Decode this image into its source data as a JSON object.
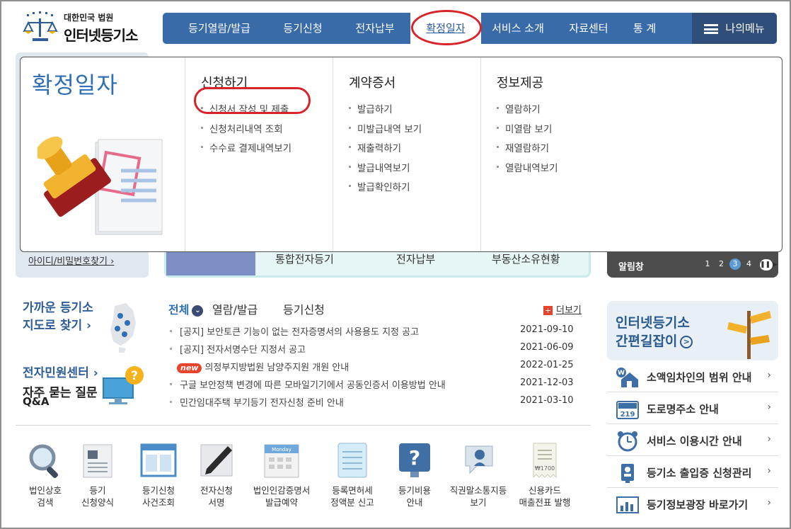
{
  "header": {
    "logo_top": "대한민국 법원",
    "logo_main": "인터넷등기소",
    "nav": [
      "등기열람/발급",
      "등기신청",
      "전자납부",
      "확정일자",
      "서비스 소개",
      "자료센터",
      "통 계"
    ],
    "active_nav": "확정일자",
    "mymenu_label": "나의메뉴"
  },
  "mega_menu": {
    "title": "확정일자",
    "columns": [
      {
        "heading": "신청하기",
        "items": [
          "신청서 작성 및 제출",
          "신청처리내역 조회",
          "수수료 결제내역보기"
        ]
      },
      {
        "heading": "계약증서",
        "items": [
          "발급하기",
          "미발급내역 보기",
          "재출력하기",
          "발급내역보기",
          "발급확인하기"
        ]
      },
      {
        "heading": "정보제공",
        "items": [
          "열람하기",
          "미열람 보기",
          "재열람하기",
          "열람내역보기"
        ]
      }
    ],
    "highlighted_item": "신청서 작성 및 제출"
  },
  "login": {
    "find_link": "아이디/비밀번호찾기 ›"
  },
  "mid_band": {
    "items": [
      "통합전자등기",
      "전자납부",
      "부동산소유현황"
    ]
  },
  "notice_bar": {
    "title": "알림창",
    "pages": [
      "1",
      "2",
      "3",
      "4"
    ],
    "current_page": "3",
    "pause": "❚❚ ▶"
  },
  "quick_left": {
    "near_title": "가까운 등기소",
    "near_sub": "지도로 찾기 ›",
    "center_title": "전자민원센터 ›",
    "faq_title": "자주 묻는 질문",
    "faq_sub": "Q&A"
  },
  "notices": {
    "tabs": [
      "전체",
      "열람/발급",
      "등기신청"
    ],
    "more_label": "더보기",
    "new_badge": "new",
    "rows": [
      {
        "title": "[공지] 보안토큰 기능이 없는 전자증명서의 사용용도 지정 공고",
        "date": "2021-09-10"
      },
      {
        "title": "[공지] 전자서명수단 지정서 공고",
        "date": "2021-06-09"
      },
      {
        "title": "의정부지방법원 남양주지원 개원 안내",
        "date": "2022-01-25"
      },
      {
        "title": "구글 보안정책 변경에 따른 모바일기기에서 공동인증서 이용방법 안내",
        "date": "2021-12-03"
      },
      {
        "title": "민간임대주택 부기등기 전자신청 준비 안내",
        "date": "2021-03-10"
      }
    ]
  },
  "quick_icons": [
    {
      "line1": "법인상호",
      "line2": "검색",
      "icon": "magnifier-icon"
    },
    {
      "line1": "등기",
      "line2": "신청양식",
      "icon": "form-icon"
    },
    {
      "line1": "등기신청",
      "line2": "사건조회",
      "icon": "window-icon"
    },
    {
      "line1": "전자신청",
      "line2": "서명",
      "icon": "pen-icon"
    },
    {
      "line1": "법인인감증명서",
      "line2": "발급예약",
      "icon": "calendar-icon",
      "calendar_label": "Monday"
    },
    {
      "line1": "등록면허세",
      "line2": "정액분 신고",
      "icon": "notebook-icon"
    },
    {
      "line1": "등기비용",
      "line2": "안내",
      "icon": "question-icon"
    },
    {
      "line1": "직권말소통지등",
      "line2": "보기",
      "icon": "notice-icon"
    },
    {
      "line1": "신용카드",
      "line2": "매출전표 발행",
      "icon": "receipt-icon",
      "receipt_amount": "₩1700"
    }
  ],
  "right_guide": {
    "line1": "인터넷등기소",
    "line2": "간편길잡이"
  },
  "right_links": [
    {
      "label": "소액임차인의 범위 안내",
      "icon": "house-icon"
    },
    {
      "label": "도로명주소 안내",
      "icon": "road-sign-icon",
      "sign_number": "219"
    },
    {
      "label": "서비스 이용시간 안내",
      "icon": "clock-icon"
    },
    {
      "label": "등기소 출입증 신청관리",
      "icon": "badge-icon"
    },
    {
      "label": "등기정보광장 바로가기",
      "icon": "chart-icon"
    }
  ],
  "colors": {
    "nav_bg": "#3a6ba9",
    "accent": "#2f6fb5",
    "highlight": "#d9232a",
    "badge": "#e8432b"
  }
}
